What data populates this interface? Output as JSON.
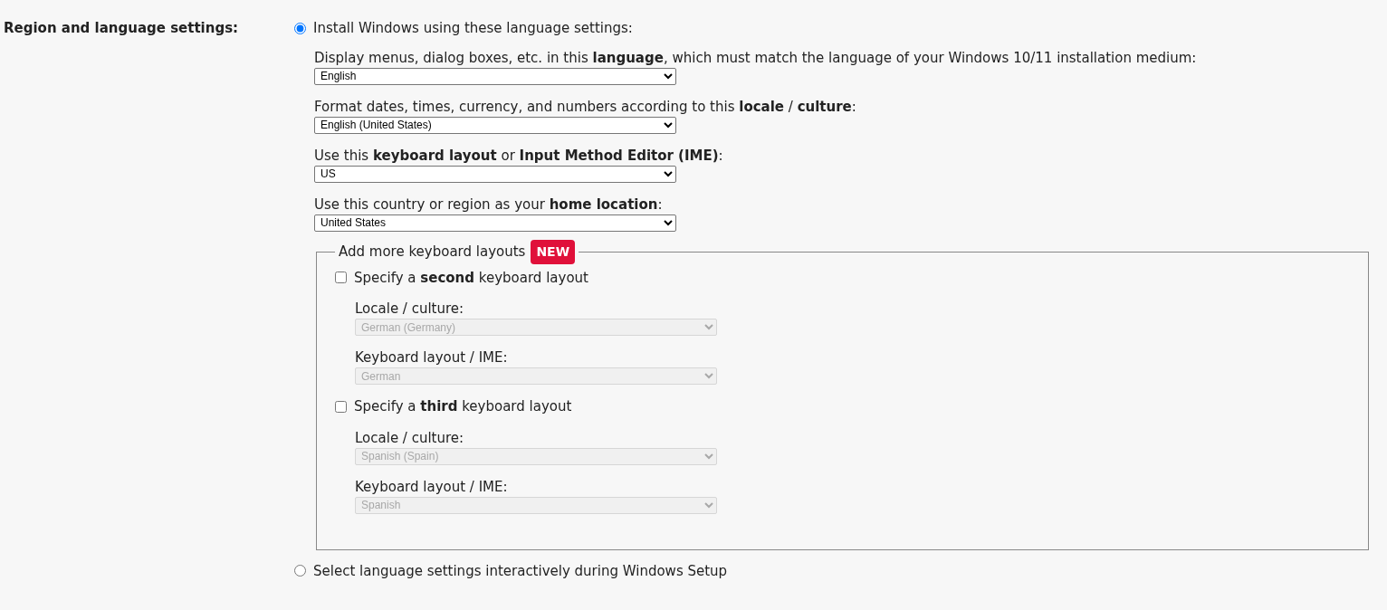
{
  "section_label": "Region and language settings:",
  "options": [
    {
      "label": "Install Windows using these language settings:",
      "selected": true
    },
    {
      "label": "Select language settings interactively during Windows Setup",
      "selected": false
    }
  ],
  "settings": [
    {
      "label": "Display menus, dialog boxes, etc. in this **language**, which must match the language of your Windows 10/11 installation medium:",
      "value": "English"
    },
    {
      "label": "Format dates, times, currency, and numbers according to this **locale** / **culture**:",
      "value": "English (United States)"
    },
    {
      "label": "Use this **keyboard layout** or **Input Method Editor (IME)**:",
      "value": "US"
    },
    {
      "label": "Use this country or region as your **home location**:",
      "value": "United States"
    }
  ],
  "keyboard_layouts": {
    "legend": "Add more keyboard layouts",
    "badge": "NEW",
    "items": [
      {
        "label": "Specify a **second** keyboard layout",
        "checked": false,
        "fields": [
          {
            "label": "Locale / culture:",
            "value": "German (Germany)"
          },
          {
            "label": "Keyboard layout / IME:",
            "value": "German"
          }
        ]
      },
      {
        "label": "Specify a **third** keyboard layout",
        "checked": false,
        "fields": [
          {
            "label": "Locale / culture:",
            "value": "Spanish (Spain)"
          },
          {
            "label": "Keyboard layout / IME:",
            "value": "Spanish"
          }
        ]
      }
    ]
  }
}
